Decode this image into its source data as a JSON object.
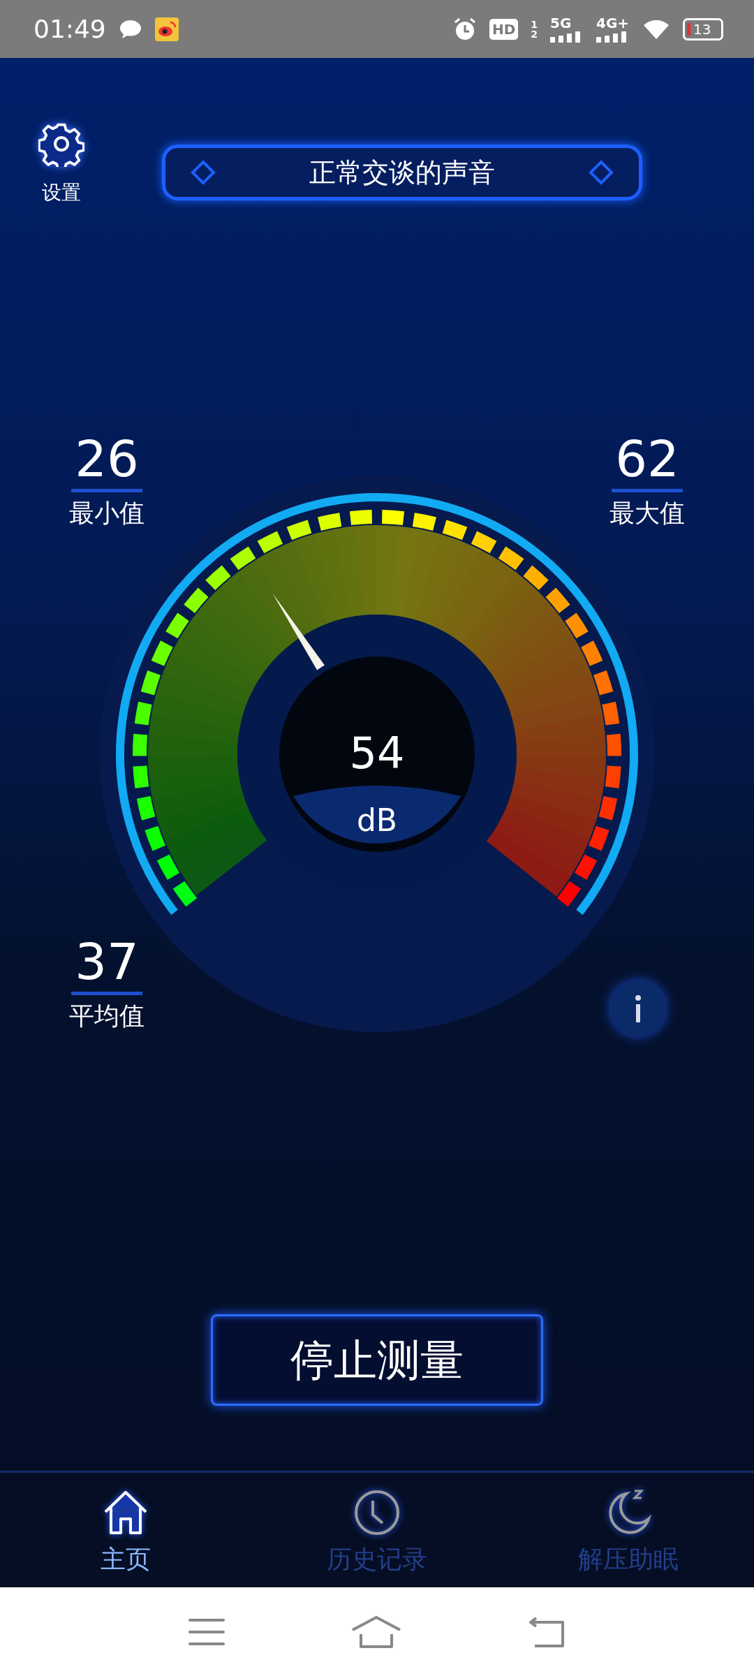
{
  "status_bar": {
    "time": "01:49",
    "hd": "HD",
    "sim_1": "1",
    "sim_2": "2",
    "network_1": "5G",
    "network_2": "4G+",
    "battery": "13"
  },
  "settings": {
    "label": "设置"
  },
  "mode_title": "正常交谈的声音",
  "stats": [
    {
      "kind": "min",
      "value": "26",
      "label": "最小值"
    },
    {
      "kind": "max",
      "value": "62",
      "label": "最大值"
    },
    {
      "kind": "avg",
      "value": "37",
      "label": "平均值"
    }
  ],
  "gauge": {
    "reading": "54",
    "unit": "dB"
  },
  "action_button": "停止测量",
  "tabs": [
    {
      "label": "主页",
      "selected": true
    },
    {
      "label": "历史记录",
      "selected": false
    },
    {
      "label": "解压助眠",
      "selected": false
    }
  ]
}
